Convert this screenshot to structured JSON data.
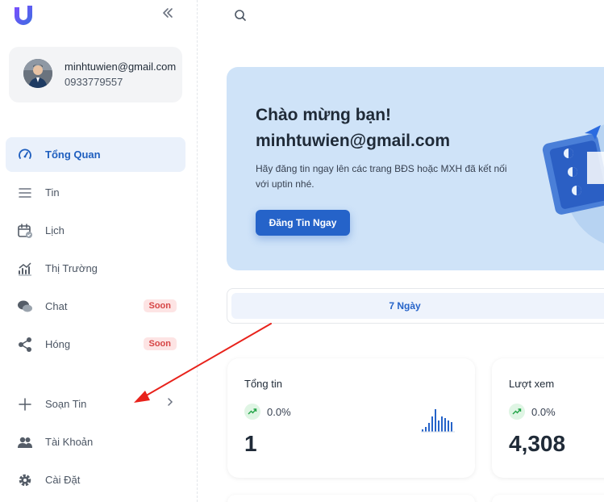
{
  "profile": {
    "email": "minhtuwien@gmail.com",
    "phone": "0933779557"
  },
  "sidebar": {
    "items": [
      {
        "label": "Tổng Quan",
        "icon": "gauge-icon",
        "active": true
      },
      {
        "label": "Tin",
        "icon": "menu-lines-icon"
      },
      {
        "label": "Lịch",
        "icon": "calendar-check-icon"
      },
      {
        "label": "Thị Trường",
        "icon": "market-chart-icon"
      },
      {
        "label": "Chat",
        "icon": "chat-bubbles-icon",
        "badge": "Soon"
      },
      {
        "label": "Hóng",
        "icon": "share-nodes-icon",
        "badge": "Soon"
      }
    ],
    "secondary": [
      {
        "label": "Soạn Tin",
        "icon": "plus-icon"
      },
      {
        "label": "Tài Khoản",
        "icon": "users-icon"
      },
      {
        "label": "Cài Đặt",
        "icon": "gear-icon"
      }
    ]
  },
  "hero": {
    "title": "Chào mừng bạn!",
    "email": "minhtuwien@gmail.com",
    "description": "Hãy đăng tin ngay lên các trang BĐS hoặc MXH đã kết nối với uptin nhé.",
    "button": "Đăng Tin Ngay"
  },
  "tabs": {
    "active": "7 Ngày"
  },
  "stats": [
    {
      "title": "Tổng tin",
      "trend": "0.0%",
      "value": "1"
    },
    {
      "title": "Lượt xem",
      "trend": "0.0%",
      "value": "4,308"
    }
  ],
  "colors": {
    "primary": "#2563c9",
    "hero_bg": "#cfe3f8",
    "active_bg": "#eaf1fb",
    "badge": "#d64545",
    "annotation": "#e8221b"
  }
}
